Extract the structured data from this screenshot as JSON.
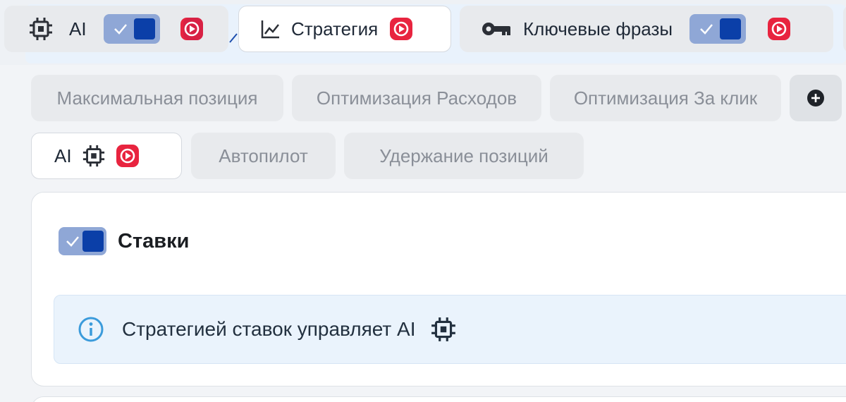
{
  "tabs": [
    {
      "label": "AI",
      "icon": "cpu-chip-icon",
      "toggle_on": true,
      "badge": "play-badge-icon"
    },
    {
      "label": "Стратегия",
      "icon": "line-chart-icon",
      "active": true,
      "badge": "play-badge-icon"
    },
    {
      "label": "Ключевые фразы",
      "icon": "key-icon",
      "toggle_on": true,
      "badge": "play-badge-icon"
    }
  ],
  "strategy_options": {
    "max_position": "Максимальная позиция",
    "opt_spend": "Оптимизация Расходов",
    "opt_click": "Оптимизация За клик",
    "add_icon": "plus-circle-icon"
  },
  "modes": {
    "ai": "AI",
    "autopilot": "Автопилот",
    "hold_positions": "Удержание позиций"
  },
  "bids": {
    "title": "Ставки",
    "toggle_on": true,
    "info_text": "Стратегией ставок управляет AI",
    "info_icon": "info-circle-icon"
  },
  "colors": {
    "toggle_track": "#8fa7d6",
    "toggle_knob": "#0b3fa8",
    "badge_red": "#e8243f",
    "info_bg": "#eaf3fc",
    "info_icon": "#3b9bdb"
  }
}
